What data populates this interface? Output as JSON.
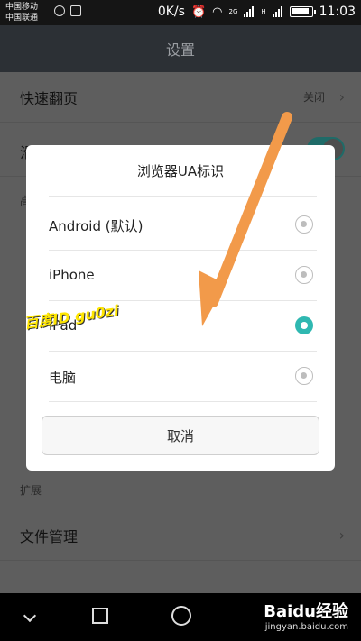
{
  "statusbar": {
    "carrier1": "中国移动",
    "carrier2": "中国联通",
    "speed": "0K/s",
    "net_2g": "2G",
    "net_h": "H",
    "time": "11:03"
  },
  "header": {
    "title": "设置"
  },
  "background": {
    "quick_page_label": "快速翻页",
    "quick_page_value": "关闭",
    "partial_row_char": "滑",
    "section_high": "高",
    "section_expand": "扩展",
    "file_manager_label": "文件管理",
    "colors": {
      "toggle_on": "#1f6b68"
    }
  },
  "dialog": {
    "title": "浏览器UA标识",
    "options": [
      {
        "label": "Android (默认)",
        "selected": false
      },
      {
        "label": "iPhone",
        "selected": false
      },
      {
        "label": "iPad",
        "selected": true
      },
      {
        "label": "电脑",
        "selected": false
      }
    ],
    "cancel_label": "取消",
    "accent": "#2fb8b1"
  },
  "annotation": {
    "watermark": "百度ID gu0zi",
    "arrow_color": "#f29a4a"
  },
  "navbar": {
    "back_icon": "back-triangle-icon",
    "home_icon": "home-circle-icon",
    "recent_icon": "recent-square-icon"
  },
  "brand": {
    "name": "Baidu经验",
    "url": "jingyan.baidu.com"
  }
}
